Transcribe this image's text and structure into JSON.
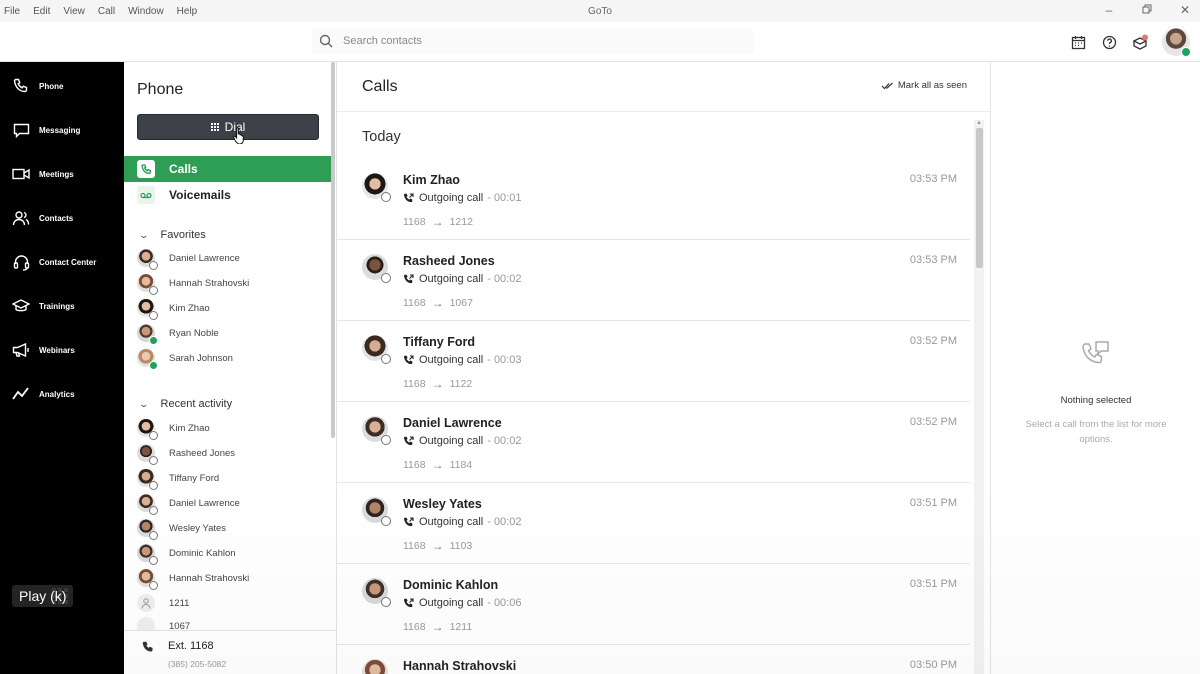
{
  "titlebar": {
    "menu": [
      "File",
      "Edit",
      "View",
      "Call",
      "Window",
      "Help"
    ],
    "app_title": "GoTo",
    "controls": [
      "minimize",
      "restore",
      "close"
    ]
  },
  "search": {
    "placeholder": "Search contacts",
    "icon": "search-icon"
  },
  "top_icons": [
    "calendar-icon",
    "help-icon",
    "notifications-icon",
    "avatar"
  ],
  "leftnav": {
    "items": [
      {
        "label": "Phone",
        "icon": "phone-icon"
      },
      {
        "label": "Messaging",
        "icon": "chat-icon"
      },
      {
        "label": "Meetings",
        "icon": "video-icon"
      },
      {
        "label": "Contacts",
        "icon": "contacts-icon"
      },
      {
        "label": "Contact Center",
        "icon": "headset-icon"
      },
      {
        "label": "Trainings",
        "icon": "graduation-cap-icon"
      },
      {
        "label": "Webinars",
        "icon": "megaphone-icon"
      },
      {
        "label": "Analytics",
        "icon": "analytics-icon"
      }
    ],
    "apps_icon": "apps-grid-icon"
  },
  "play_tooltip": "Play (k)",
  "phone_panel": {
    "title": "Phone",
    "dial_label": "Dial",
    "nav": [
      {
        "label": "Calls",
        "active": true
      },
      {
        "label": "Voicemails",
        "active": false
      }
    ],
    "favorites_label": "Favorites",
    "favorites": [
      {
        "name": "Daniel Lawrence",
        "online": false
      },
      {
        "name": "Hannah Strahovski",
        "online": false
      },
      {
        "name": "Kim Zhao",
        "online": false
      },
      {
        "name": "Ryan Noble",
        "online": true
      },
      {
        "name": "Sarah Johnson",
        "online": true
      }
    ],
    "recent_label": "Recent activity",
    "recent": [
      {
        "name": "Kim Zhao"
      },
      {
        "name": "Rasheed Jones"
      },
      {
        "name": "Tiffany Ford"
      },
      {
        "name": "Daniel Lawrence"
      },
      {
        "name": "Wesley Yates"
      },
      {
        "name": "Dominic Kahlon"
      },
      {
        "name": "Hannah Strahovski"
      },
      {
        "name": "1211"
      },
      {
        "name": "1067"
      }
    ],
    "extension": "Ext. 1168",
    "extension_number": "(385) 205-5082"
  },
  "calls": {
    "title": "Calls",
    "mark_all": "Mark all as seen",
    "group": "Today",
    "items": [
      {
        "name": "Kim Zhao",
        "direction": "Outgoing call",
        "duration": "- 00:01",
        "from": "1168",
        "to": "1212",
        "time": "03:53 PM"
      },
      {
        "name": "Rasheed Jones",
        "direction": "Outgoing call",
        "duration": "- 00:02",
        "from": "1168",
        "to": "1067",
        "time": "03:53 PM"
      },
      {
        "name": "Tiffany Ford",
        "direction": "Outgoing call",
        "duration": "- 00:03",
        "from": "1168",
        "to": "1122",
        "time": "03:52 PM"
      },
      {
        "name": "Daniel Lawrence",
        "direction": "Outgoing call",
        "duration": "- 00:02",
        "from": "1168",
        "to": "1184",
        "time": "03:52 PM"
      },
      {
        "name": "Wesley Yates",
        "direction": "Outgoing call",
        "duration": "- 00:02",
        "from": "1168",
        "to": "1103",
        "time": "03:51 PM"
      },
      {
        "name": "Dominic Kahlon",
        "direction": "Outgoing call",
        "duration": "- 00:06",
        "from": "1168",
        "to": "1211",
        "time": "03:51 PM"
      },
      {
        "name": "Hannah Strahovski",
        "direction": "",
        "duration": "",
        "from": "",
        "to": "",
        "time": "03:50 PM"
      }
    ]
  },
  "detail": {
    "title": "Nothing selected",
    "description": "Select a call from the list for more options."
  },
  "colors": {
    "accent": "#2e9e55",
    "nav_bg": "#000000",
    "dial_bg": "#3b4147",
    "online": "#1fa35c"
  }
}
